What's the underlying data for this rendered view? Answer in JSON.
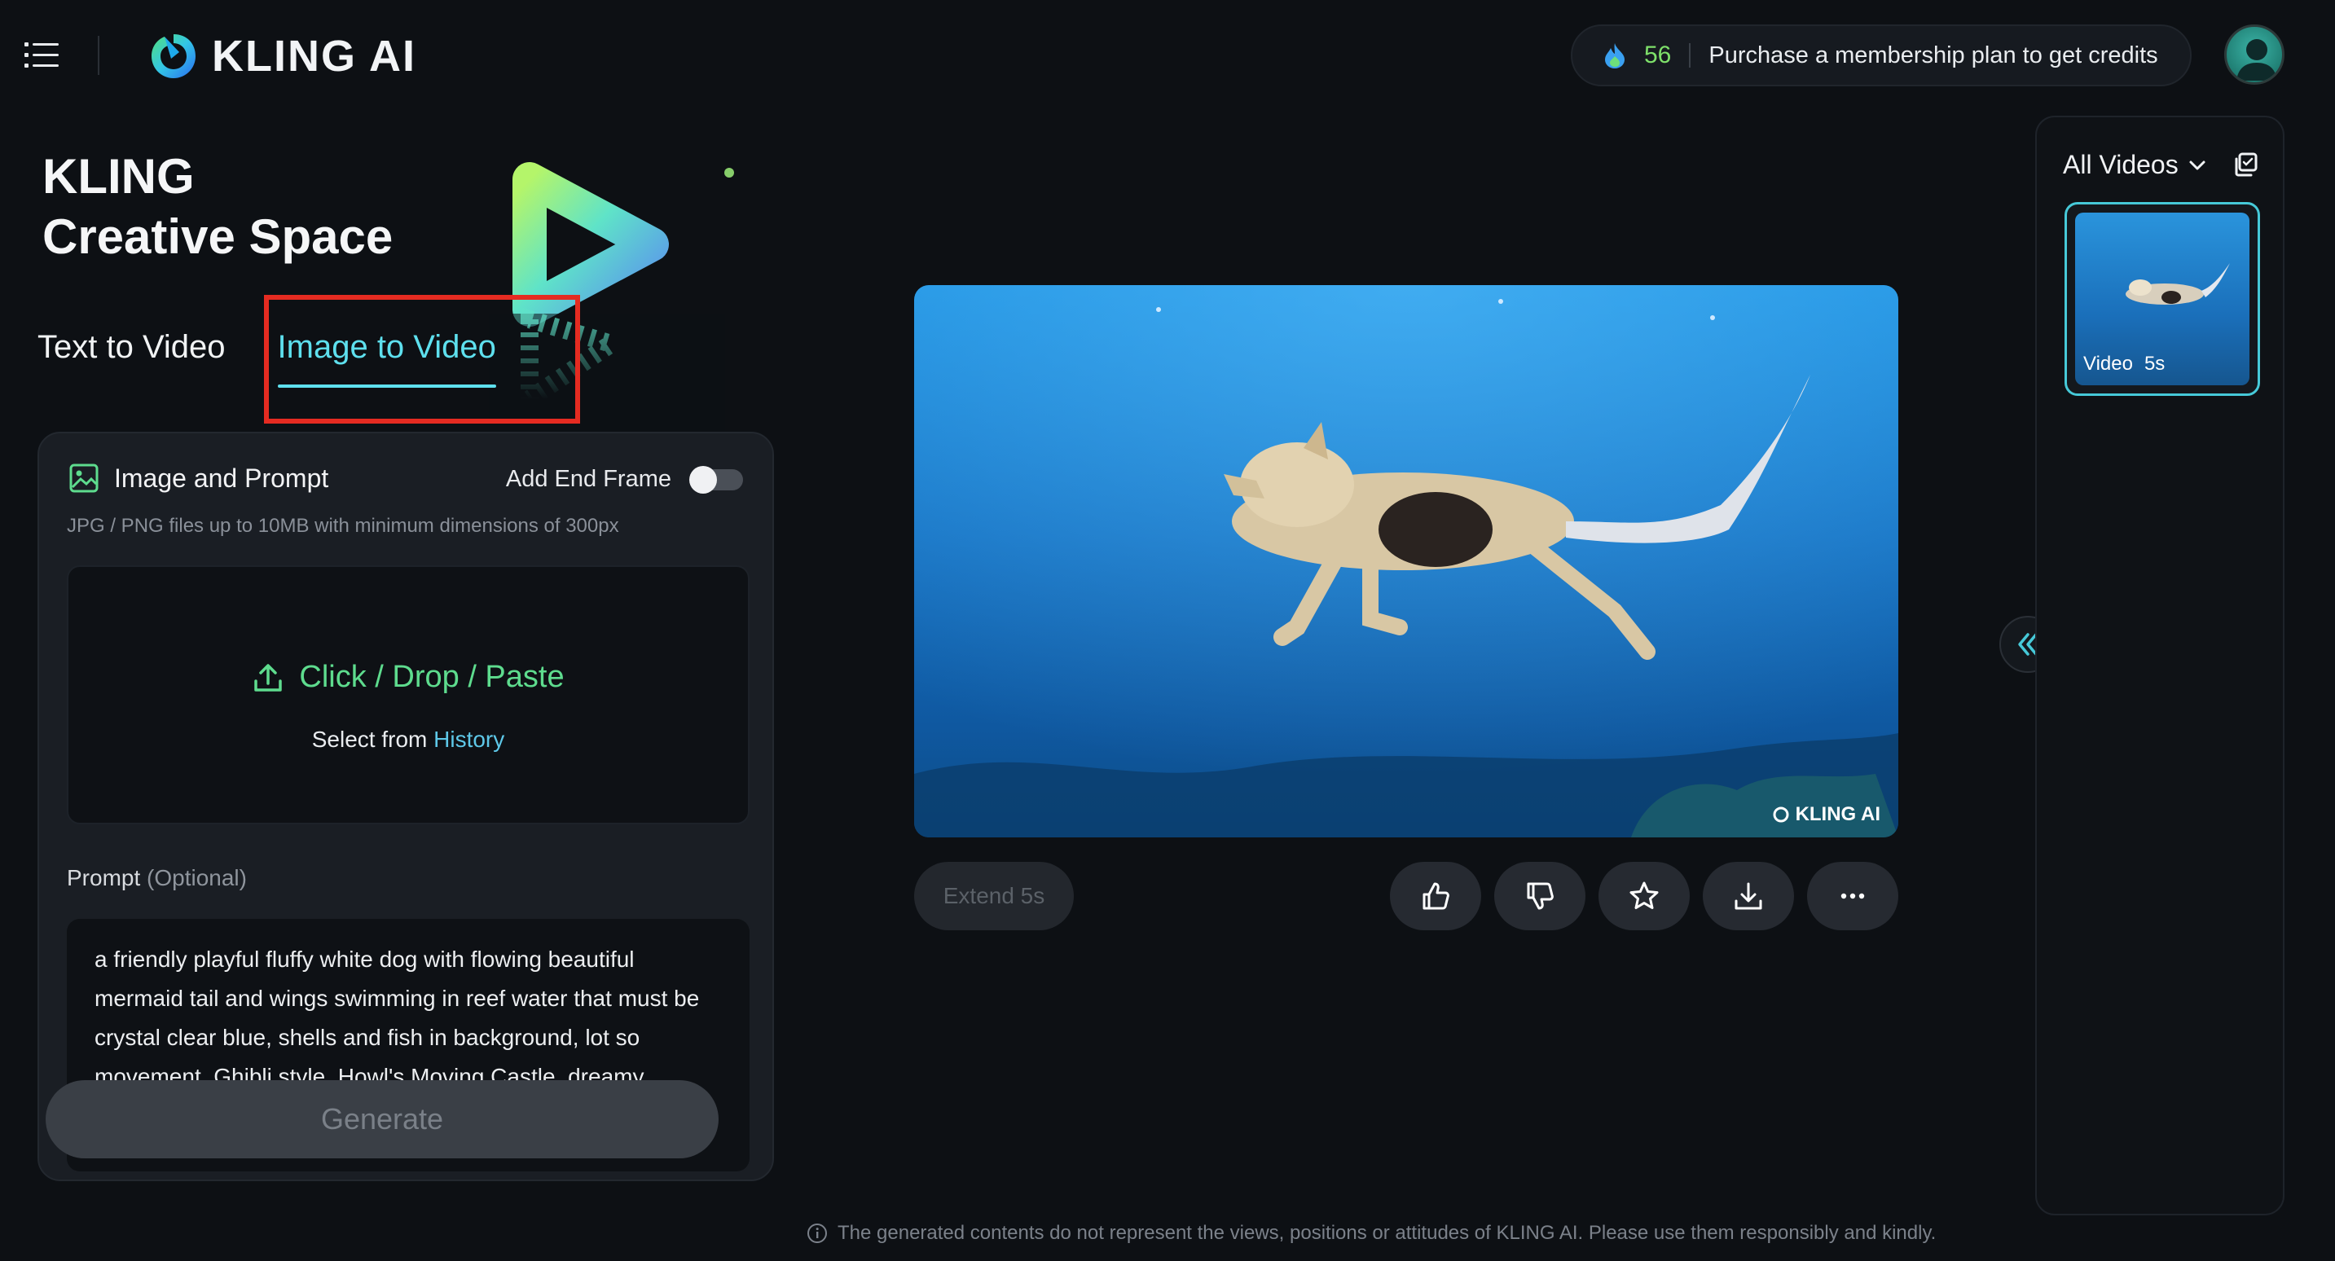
{
  "header": {
    "logo_text": "KLING AI",
    "credits": "56",
    "purchase_text": "Purchase a membership plan to get credits"
  },
  "hero": {
    "line1": "KLING",
    "line2": "Creative Space"
  },
  "tabs": [
    {
      "label": "Text to Video",
      "active": false
    },
    {
      "label": "Image to Video",
      "active": true
    }
  ],
  "panel": {
    "title": "Image and Prompt",
    "end_frame_label": "Add End Frame",
    "end_frame_enabled": false,
    "hint": "JPG / PNG files up to 10MB with minimum dimensions of 300px",
    "drop_text": "Click / Drop / Paste",
    "select_from": "Select from",
    "history_link": "History",
    "prompt_label": "Prompt",
    "prompt_optional": "(Optional)",
    "prompt_value": "a friendly playful fluffy white dog with flowing beautiful mermaid tail and wings swimming in reef water that must be crystal clear blue, shells and fish in background, lot so movement, Ghibli style, Howl's Moving Castle, dreamy",
    "generate_label": "Generate"
  },
  "player": {
    "watermark": "KLING AI",
    "extend_label": "Extend 5s",
    "actions": [
      "thumbs-up-icon",
      "thumbs-down-icon",
      "star-icon",
      "download-icon",
      "more-icon"
    ]
  },
  "sidebar": {
    "filter_label": "All Videos",
    "thumb_type": "Video",
    "thumb_duration": "5s"
  },
  "footer": {
    "disclaimer": "The generated contents do not represent the views, positions or attitudes of KLING AI. Please use them responsibly and kindly."
  },
  "colors": {
    "accent": "#5ee0ee",
    "green": "#5edc8e",
    "highlight_box": "#e52b21"
  }
}
